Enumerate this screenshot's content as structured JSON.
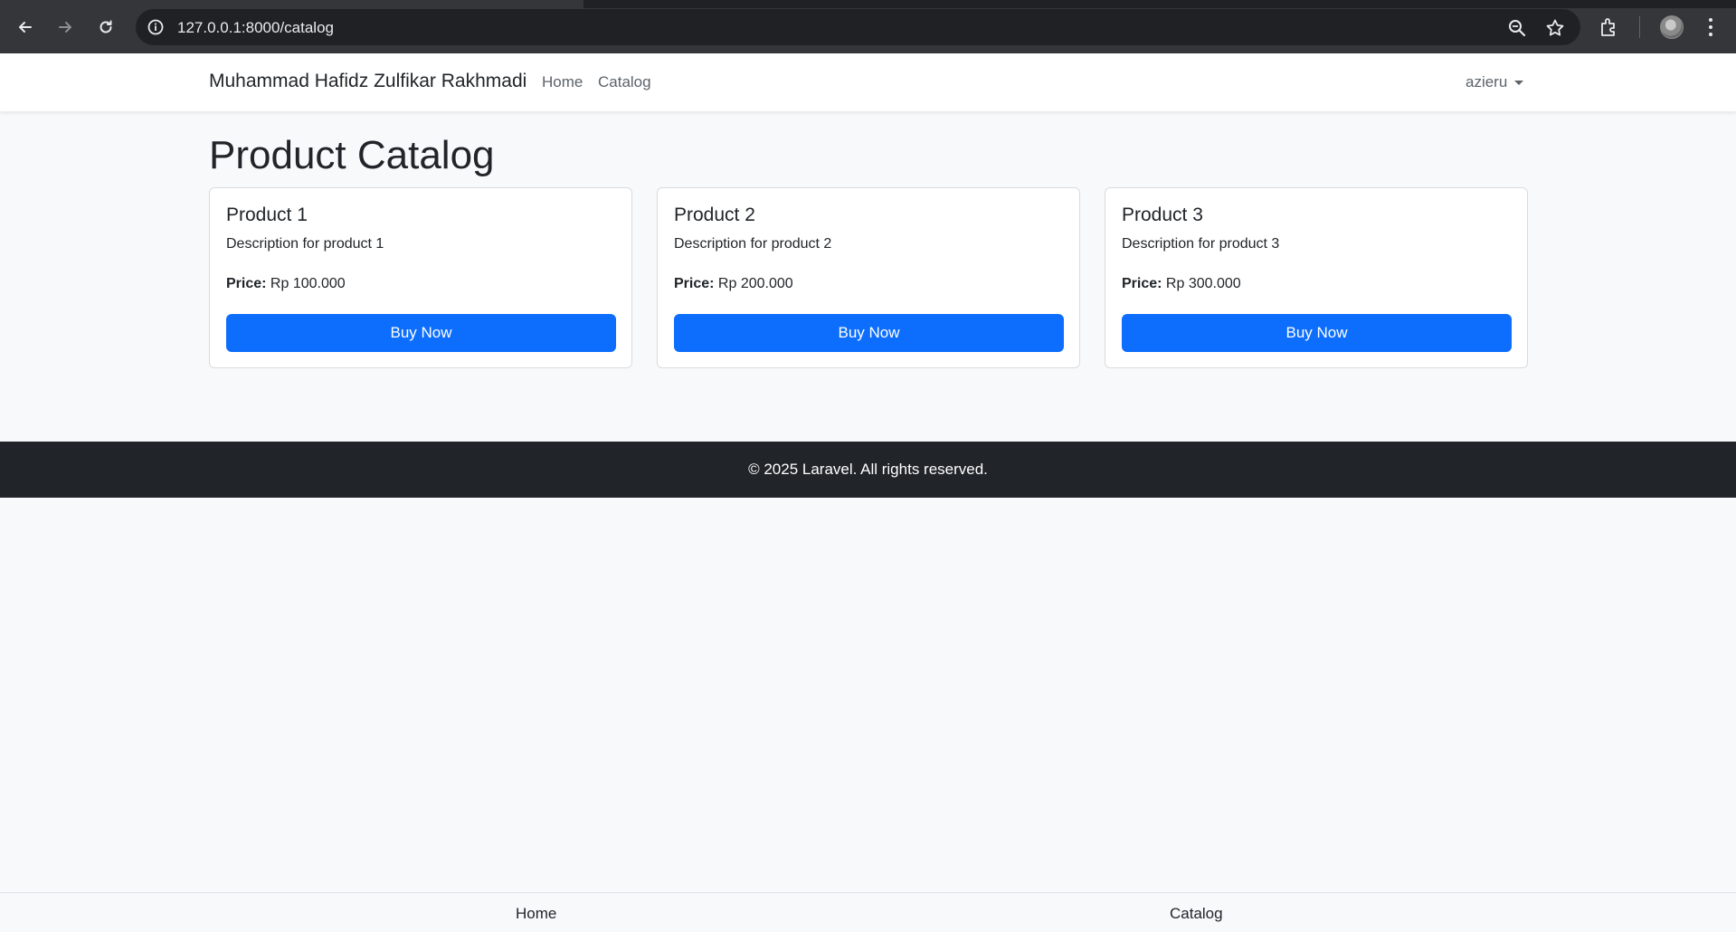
{
  "browser": {
    "url": "127.0.0.1:8000/catalog",
    "icons": [
      "back-arrow-icon",
      "forward-arrow-icon",
      "reload-icon",
      "site-info-icon",
      "zoom-icon",
      "bookmark-star-icon",
      "extensions-icon",
      "profile-avatar",
      "more-menu-icon"
    ]
  },
  "navbar": {
    "brand": "Muhammad Hafidz Zulfikar Rakhmadi",
    "links": [
      "Home",
      "Catalog"
    ],
    "user": "azieru"
  },
  "page": {
    "title": "Product Catalog"
  },
  "products": [
    {
      "name": "Product 1",
      "description": "Description for product 1",
      "price_label": "Price:",
      "price": "Rp 100.000",
      "button": "Buy Now"
    },
    {
      "name": "Product 2",
      "description": "Description for product 2",
      "price_label": "Price:",
      "price": "Rp 200.000",
      "button": "Buy Now"
    },
    {
      "name": "Product 3",
      "description": "Description for product 3",
      "price_label": "Price:",
      "price": "Rp 300.000",
      "button": "Buy Now"
    }
  ],
  "footer": {
    "text": "© 2025 Laravel. All rights reserved."
  },
  "bottom_nav": {
    "links": [
      "Home",
      "Catalog"
    ]
  },
  "colors": {
    "primary": "#0d6efd",
    "footer_bg": "#212529",
    "page_bg": "#f8f9fa"
  }
}
